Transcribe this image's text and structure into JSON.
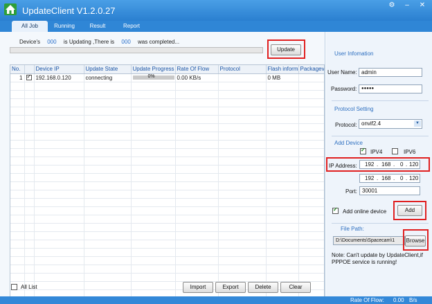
{
  "window": {
    "title": "UpdateClient V1.2.0.27"
  },
  "tabs": [
    {
      "label": "All Job"
    },
    {
      "label": "Running"
    },
    {
      "label": "Result"
    },
    {
      "label": "Report"
    }
  ],
  "status": {
    "prefix": "Device's",
    "updating_count": "000",
    "middle": "is Updating ,There is",
    "completed_count": "000",
    "suffix": "was completed..."
  },
  "update_button": "Update",
  "table": {
    "columns": [
      "No.",
      "",
      "Device IP",
      "Update State",
      "Update Progress",
      "Rate Of Flow",
      "Protocol",
      "Flash informa",
      "Packageve"
    ],
    "rows": [
      {
        "no": "1",
        "ip": "192.168.0.120",
        "state": "connecting",
        "progress": "0%",
        "rate": "0.00 KB/s",
        "protocol": "",
        "flash": "0 MB",
        "package": ""
      }
    ]
  },
  "bottom": {
    "all_list": "All List",
    "import": "Import",
    "export": "Export",
    "delete": "Delete",
    "clear": "Clear"
  },
  "right": {
    "user_info_title": "User Infomation",
    "user_name_label": "User Name:",
    "user_name_value": "admin",
    "password_label": "Password:",
    "password_value": "●●●●●",
    "protocol_title": "Protocol Setting",
    "protocol_label": "Protocol:",
    "protocol_value": "onvif2.4",
    "add_device_title": "Add Device",
    "ipv4_label": "IPV4",
    "ipv6_label": "IPV6",
    "ip_address_label": "IP Address:",
    "ip_start": [
      "192",
      "168",
      "0",
      "120"
    ],
    "ip_end": [
      "192",
      "168",
      "0",
      "120"
    ],
    "port_label": "Port:",
    "port_value": "30001",
    "add_online_label": "Add online device",
    "add_button": "Add",
    "file_path_title": "File Path:",
    "file_path_value": "D:\\Documents\\Spacecam\\1",
    "browse_button": "Browse",
    "note": "Note: Can't update by UpdateClient,if PPPOE service is running!"
  },
  "statusbar": {
    "rate_label": "Rate Of Flow:",
    "rate_value": "0.00",
    "rate_unit": "B/s"
  },
  "colors": {
    "title_bar": "#2a7fd0",
    "accent": "#2d6fc0",
    "highlight": "#e02020"
  }
}
